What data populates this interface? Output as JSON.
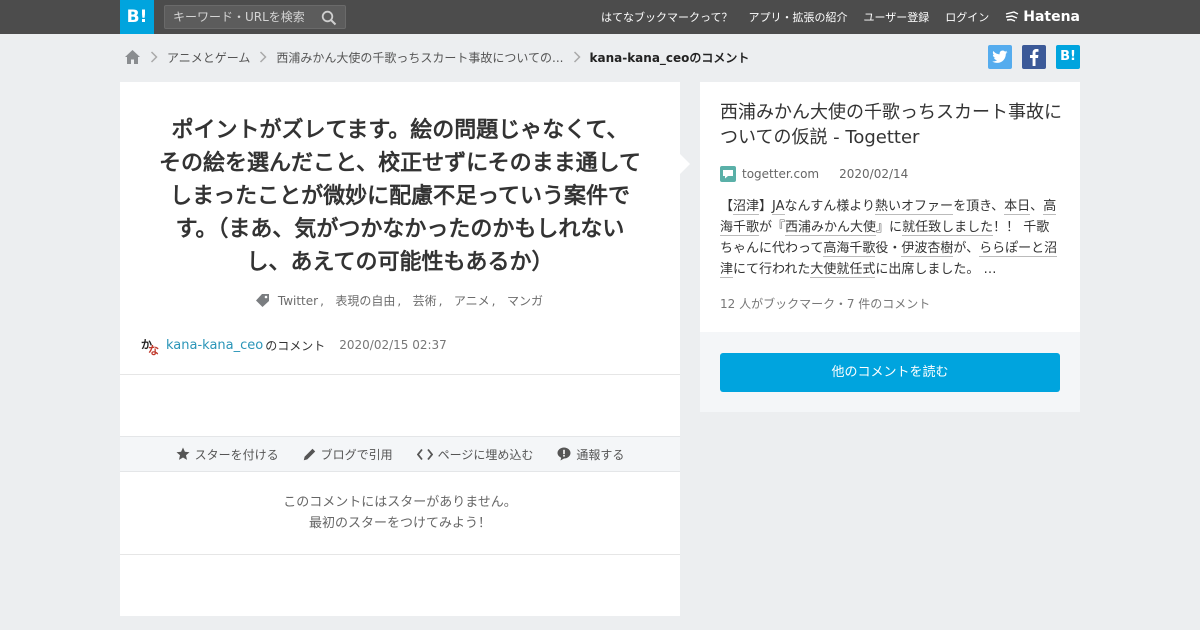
{
  "header": {
    "logo": "B!",
    "search_placeholder": "キーワード・URLを検索",
    "nav": [
      "はてなブックマークって？",
      "アプリ・拡張の紹介",
      "ユーザー登録",
      "ログイン"
    ],
    "brand": "Hatena"
  },
  "breadcrumb": {
    "items": [
      "アニメとゲーム",
      "西浦みかん大使の千歌っちスカート事故についての..."
    ],
    "current": "kana-kana_ceoのコメント"
  },
  "share": {
    "twitter": "t",
    "facebook": "f",
    "hatena": "B!"
  },
  "comment": {
    "lines": [
      "ポイントがズレてます。絵の問題じゃなくて、",
      "その絵を選んだこと、校正せずにそのまま通して",
      "しまったことが微妙に配慮不足っていう案件で",
      "す。（まあ、気がつかなかったのかもしれない",
      "し、あえての可能性もあるか）"
    ],
    "tags": [
      "Twitter",
      "表現の自由",
      "芸術",
      "アニメ",
      "マンガ"
    ],
    "avatar_chars": [
      "か",
      "な"
    ],
    "user": "kana-kana_ceo",
    "user_suffix": "のコメント",
    "date": "2020/02/15 02:37"
  },
  "actions": {
    "star": "スターを付ける",
    "blog": "ブログで引用",
    "embed": "ページに埋め込む",
    "report": "通報する"
  },
  "stars": {
    "line1": "このコメントにはスターがありません。",
    "line2": "最初のスターをつけてみよう！"
  },
  "entry": {
    "title": "西浦みかん大使の千歌っちスカート事故についての仮説 - Togetter",
    "domain": "togetter.com",
    "date": "2020/02/14",
    "description_segments": [
      {
        "t": "【",
        "u": false
      },
      {
        "t": "沼津",
        "u": true
      },
      {
        "t": "】",
        "u": false
      },
      {
        "t": "JA",
        "u": true
      },
      {
        "t": "なんすん様より",
        "u": false
      },
      {
        "t": "熱い",
        "u": true
      },
      {
        "t": "オファー",
        "u": true
      },
      {
        "t": "を頂き、",
        "u": false
      },
      {
        "t": "本日",
        "u": true
      },
      {
        "t": "、",
        "u": false
      },
      {
        "t": "高海千歌",
        "u": true
      },
      {
        "t": "が『",
        "u": false
      },
      {
        "t": "西浦みかん大使",
        "u": true
      },
      {
        "t": "』に",
        "u": false
      },
      {
        "t": "就任致しました",
        "u": true
      },
      {
        "t": "！！ 千歌ちゃんに代わって",
        "u": false
      },
      {
        "t": "高海千歌",
        "u": true
      },
      {
        "t": "役・",
        "u": false
      },
      {
        "t": "伊波杏樹",
        "u": true
      },
      {
        "t": "が、",
        "u": false
      },
      {
        "t": "ららぽーと沼津",
        "u": true
      },
      {
        "t": "にて行われた",
        "u": false
      },
      {
        "t": "大使就任式",
        "u": true
      },
      {
        "t": "に出席しました。 …",
        "u": false
      }
    ],
    "meta": "12 人がブックマーク・7 件のコメント",
    "more_button": "他のコメントを読む"
  },
  "colors": {
    "accent": "#00a4de",
    "twitter": "#55acee",
    "facebook": "#3b5998"
  }
}
